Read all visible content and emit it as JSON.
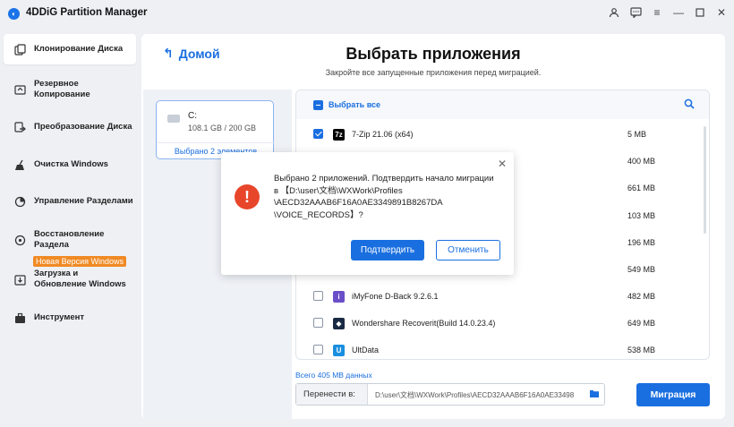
{
  "app": {
    "title": "4DDiG Partition Manager"
  },
  "sidebar": {
    "items": [
      {
        "label": "Клонирование Диска",
        "icon": "clone-disk-icon"
      },
      {
        "label": "Резервное Копирование",
        "icon": "backup-icon"
      },
      {
        "label": "Преобразование Диска",
        "icon": "convert-disk-icon"
      },
      {
        "label": "Очистка Windows",
        "icon": "broom-icon"
      },
      {
        "label": "Управление Разделами",
        "icon": "partition-icon"
      },
      {
        "label": "Восстановление Раздела",
        "icon": "restore-icon"
      },
      {
        "label": "Загрузка и Обновление Windows",
        "icon": "download-icon"
      },
      {
        "label": "Инструмент",
        "icon": "toolbox-icon"
      }
    ],
    "badge": "Новая Версия Windows"
  },
  "main": {
    "back_label": "Домой",
    "title": "Выбрать приложения",
    "subtitle": "Закройте все запущенные приложения перед миграцией.",
    "disk": {
      "name": "C:",
      "size": "108.1 GB / 200 GB",
      "selected": "Выбрано 2 элементов"
    },
    "list": {
      "select_all": "Выбрать все",
      "apps": [
        {
          "name": "7-Zip 21.06 (x64)",
          "size": "5 MB",
          "checked": true,
          "icon_color": "#000000"
        },
        {
          "name": "",
          "size": "400 MB",
          "checked": false
        },
        {
          "name": "",
          "size": "661 MB",
          "checked": false
        },
        {
          "name": "",
          "size": "103 MB",
          "checked": false
        },
        {
          "name": "",
          "size": "196 MB",
          "checked": false
        },
        {
          "name": "",
          "size": "549 MB",
          "checked": false
        },
        {
          "name": "iMyFone D-Back 9.2.6.1",
          "size": "482 MB",
          "checked": false,
          "icon_color": "#6b4fc8"
        },
        {
          "name": "Wondershare Recoverit(Build 14.0.23.4)",
          "size": "649 MB",
          "checked": false,
          "icon_color": "#1a2a44"
        },
        {
          "name": "UltData",
          "size": "538 MB",
          "checked": false,
          "icon_color": "#1a8fe0"
        }
      ]
    },
    "total": "Всего 405 MB данных",
    "destination": {
      "label": "Перенести в:",
      "path": "D:\\user\\文档\\WXWork\\Profiles\\AECD32AAAB6F16A0AE33498"
    },
    "migrate_label": "Миграция"
  },
  "dialog": {
    "lines": [
      "Выбрано 2 приложений. Подтвердить начало миграции",
      "в 【D:\\user\\文档\\WXWork\\Profiles",
      "\\AECD32AAAB6F16A0AE3349891B8267DA",
      "\\VOICE_RECORDS】?"
    ],
    "confirm": "Подтвердить",
    "cancel": "Отменить"
  },
  "colors": {
    "accent": "#1a6fe0",
    "warning": "#e8462b",
    "badge": "#f08a24"
  }
}
